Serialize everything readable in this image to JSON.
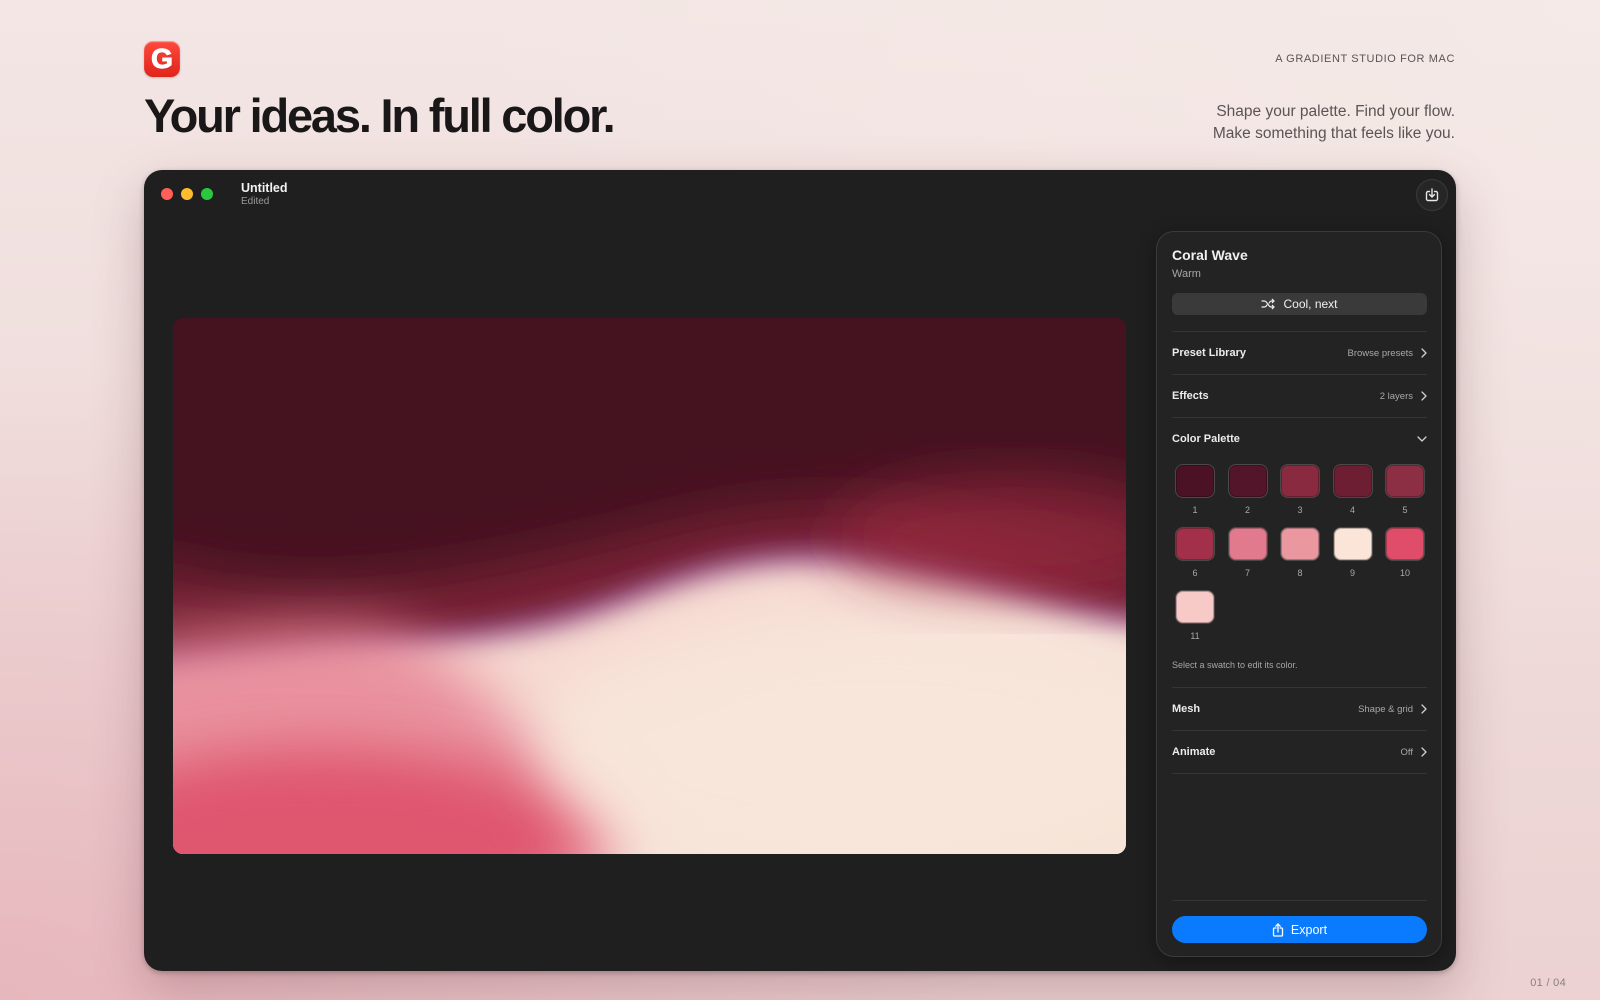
{
  "brand": {
    "logo_letter": "G",
    "tagline": "A GRADIENT STUDIO FOR MAC",
    "headline": "Your ideas. In full color.",
    "subcopy_line1": "Shape your palette. Find your flow.",
    "subcopy_line2": "Make something that feels like you."
  },
  "window": {
    "title": "Untitled",
    "status": "Edited"
  },
  "panel": {
    "preset_name": "Coral Wave",
    "preset_tag": "Warm",
    "shuffle_label": "Cool, next",
    "rows": [
      {
        "label": "Preset Library",
        "value": "Browse presets"
      },
      {
        "label": "Effects",
        "value": "2 layers"
      },
      {
        "label": "Color Palette",
        "value": ""
      },
      {
        "label": "Mesh",
        "value": "Shape & grid"
      },
      {
        "label": "Animate",
        "value": "Off"
      }
    ],
    "swatches": [
      {
        "num": "1",
        "color": "#4a1224"
      },
      {
        "num": "2",
        "color": "#52152a"
      },
      {
        "num": "3",
        "color": "#8a2a40"
      },
      {
        "num": "4",
        "color": "#6e1e33"
      },
      {
        "num": "5",
        "color": "#8c2e44"
      },
      {
        "num": "6",
        "color": "#a3304a"
      },
      {
        "num": "7",
        "color": "#e07a8c"
      },
      {
        "num": "8",
        "color": "#ea97a0"
      },
      {
        "num": "9",
        "color": "#fbe4d8"
      },
      {
        "num": "10",
        "color": "#df4d6a"
      },
      {
        "num": "11",
        "color": "#f7c9c7"
      }
    ],
    "palette_hint": "Select a swatch to edit its color.",
    "export_label": "Export"
  },
  "pager": "01 / 04",
  "colors": {
    "accent": "#0a7aff",
    "window_bg": "#1f1f1f",
    "panel_bg": "#242323"
  }
}
